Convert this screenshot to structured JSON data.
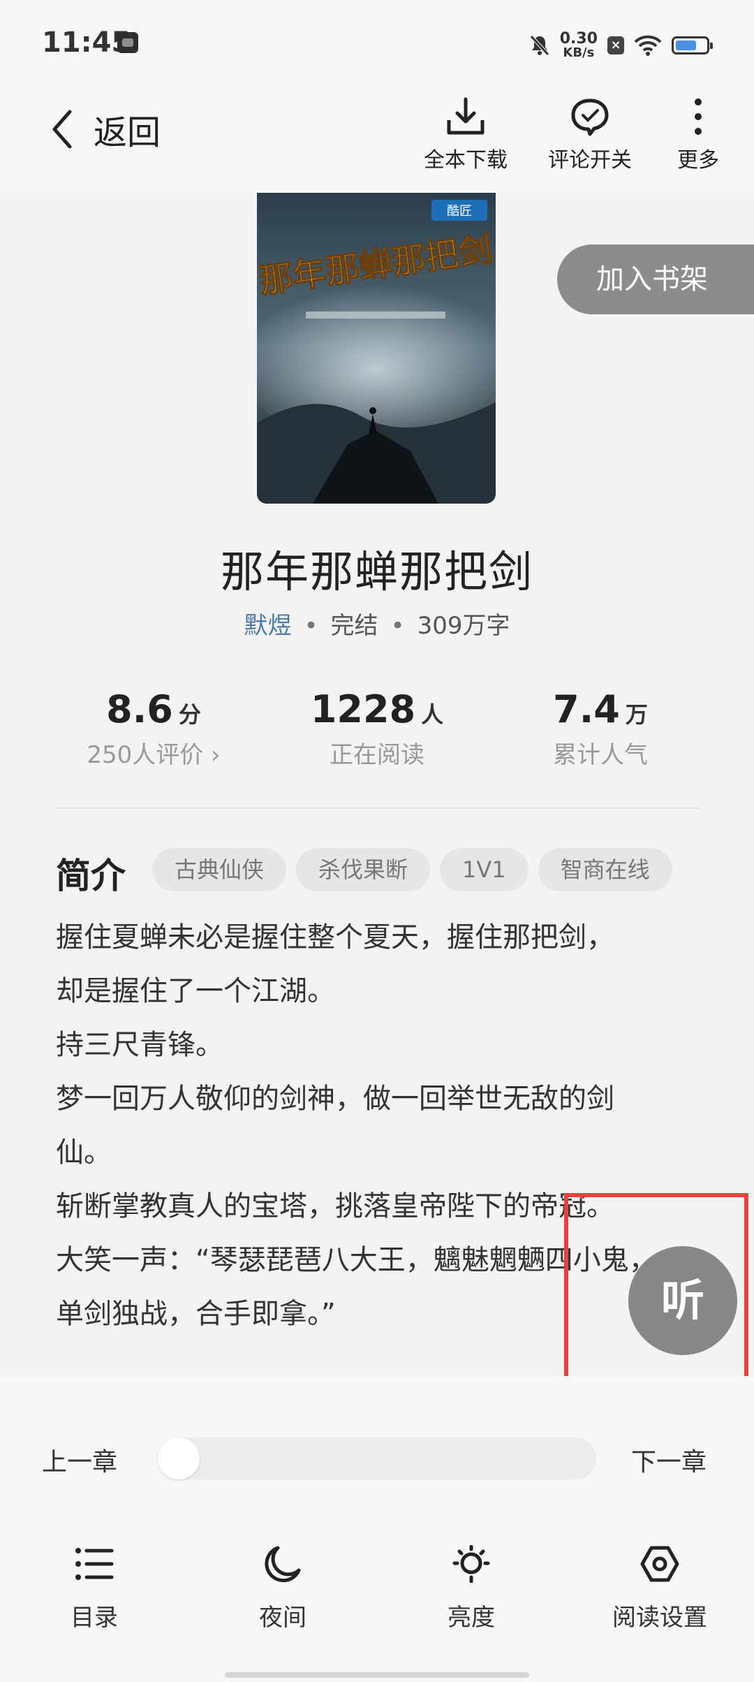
{
  "status_bar": {
    "time": "11:45",
    "net_speed_value": "0.30",
    "net_speed_unit": "KB/s",
    "icons": [
      "app-notification-icon",
      "mute-icon",
      "close-box-icon",
      "wifi-icon",
      "battery-icon"
    ],
    "battery_level": 0.7
  },
  "nav": {
    "back_label": "返回",
    "download_label": "全本下载",
    "comments_label": "评论开关",
    "more_label": "更多"
  },
  "book": {
    "cover_title": "那年那蝉那把剑",
    "cover_badge": "酷匠",
    "add_to_shelf": "加入书架",
    "title": "那年那蝉那把剑",
    "author": "默煜",
    "status": "完结",
    "word_count": "309万字",
    "separator": "•"
  },
  "stats": {
    "score": "8.6",
    "score_unit": "分",
    "score_sub": "250人评价 ›",
    "reading": "1228",
    "reading_unit": "人",
    "reading_sub": "正在阅读",
    "popularity": "7.4",
    "popularity_unit": "万",
    "popularity_sub": "累计人气"
  },
  "intro": {
    "heading": "简介",
    "tags": [
      "古典仙侠",
      "杀伐果断",
      "1V1",
      "智商在线"
    ],
    "lines": [
      "握住夏蝉未必是握住整个夏天，握住那把剑，",
      "却是握住了一个江湖。",
      "持三尺青锋。",
      "梦一回万人敬仰的剑神，做一回举世无敌的剑",
      "仙。",
      "斩断掌教真人的宝塔，挑落皇帝陛下的帝冠。",
      "大笑一声：“琴瑟琵琶八大王，魑魅魍魉四小鬼，",
      "单剑独战，合手即拿。”"
    ]
  },
  "listen_label": "听",
  "chapter_nav": {
    "prev": "上一章",
    "next": "下一章",
    "progress": 0
  },
  "toolbar": {
    "toc": "目录",
    "night": "夜间",
    "brightness": "亮度",
    "settings": "阅读设置"
  },
  "colors": {
    "accent_author": "#4a7aa7",
    "highlight": "#e5433f",
    "button_gray": "#878787"
  }
}
